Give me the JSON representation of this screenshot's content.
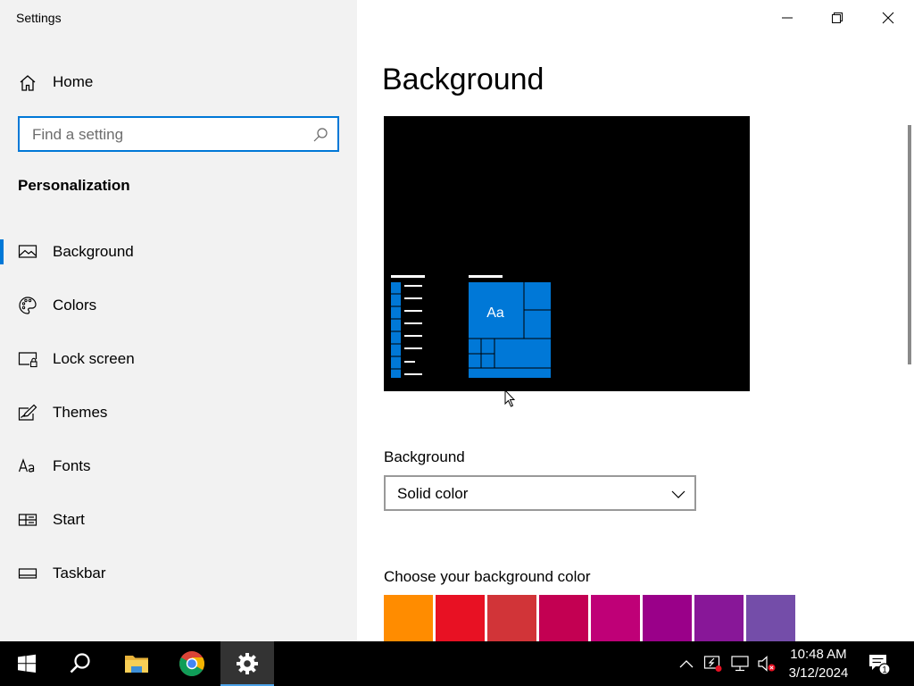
{
  "window": {
    "title": "Settings",
    "controls": {
      "minimize": "minimize",
      "maximize": "restore",
      "close": "close"
    }
  },
  "sidebar": {
    "home_label": "Home",
    "search": {
      "placeholder": "Find a setting",
      "value": ""
    },
    "section_title": "Personalization",
    "items": [
      {
        "label": "Background",
        "icon": "picture-icon",
        "active": true
      },
      {
        "label": "Colors",
        "icon": "palette-icon"
      },
      {
        "label": "Lock screen",
        "icon": "lock-screen-icon"
      },
      {
        "label": "Themes",
        "icon": "themes-icon"
      },
      {
        "label": "Fonts",
        "icon": "fonts-icon"
      },
      {
        "label": "Start",
        "icon": "start-icon"
      },
      {
        "label": "Taskbar",
        "icon": "taskbar-icon"
      }
    ]
  },
  "main": {
    "page_title": "Background",
    "preview": {
      "sample_text": "Aa",
      "background_color": "#000000",
      "accent": "#0078d7"
    },
    "background_field": {
      "label": "Background",
      "value": "Solid color"
    },
    "color_section": {
      "label": "Choose your background color",
      "swatches": [
        "#ff8c00",
        "#e81123",
        "#d13438",
        "#c30052",
        "#bf0077",
        "#9a0089",
        "#881798",
        "#744da9"
      ]
    }
  },
  "taskbar": {
    "apps": [
      "start-icon",
      "search-icon",
      "file-explorer-icon",
      "chrome-icon",
      "settings-icon"
    ],
    "active_app": "settings-icon",
    "tray": [
      "chevron-up-icon",
      "security-icon",
      "network-icon",
      "volume-muted-icon"
    ],
    "clock": {
      "time": "10:48 AM",
      "date": "3/12/2024"
    },
    "notification_count": "1"
  },
  "colors": {
    "accent": "#0078d7",
    "sidebar_bg": "#f2f2f2",
    "taskbar_bg": "#000000"
  }
}
